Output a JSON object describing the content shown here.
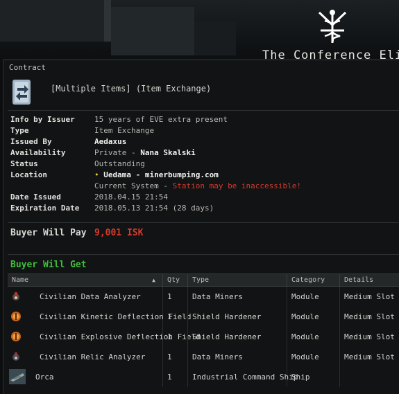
{
  "background": {
    "corp_title": "The Conference Elite",
    "logo_icon": "caduceus-logo-icon"
  },
  "window": {
    "title": "Contract",
    "contract_icon": "contract-scroll-icon",
    "contract_name": "[Multiple Items] (Item Exchange)"
  },
  "info": {
    "info_by_issuer_label": "Info by Issuer",
    "info_by_issuer": "15 years of EVE extra present",
    "type_label": "Type",
    "type": "Item Exchange",
    "issued_by_label": "Issued By",
    "issued_by": "Aedaxus",
    "availability_label": "Availability",
    "availability_prefix": "Private - ",
    "availability_name": "Nana Skalski",
    "status_label": "Status",
    "status": "Outstanding",
    "location_label": "Location",
    "location": "Uedama - minerbumping.com",
    "current_system_prefix": "Current System - ",
    "current_system_warning": "Station may be inaccessible!",
    "date_issued_label": "Date Issued",
    "date_issued": "2018.04.15 21:54",
    "expiration_label": "Expiration Date",
    "expiration": "2018.05.13 21:54 (28 days)"
  },
  "buyer_will_pay_label": "Buyer Will Pay",
  "buyer_will_pay": "9,001 ISK",
  "buyer_will_get_label": "Buyer Will Get",
  "table": {
    "headers": [
      "Name",
      "Qty",
      "Type",
      "Category",
      "Details"
    ],
    "rows": [
      {
        "icon": "data-analyzer-icon",
        "name": "Civilian Data Analyzer",
        "qty": "1",
        "type": "Data Miners",
        "category": "Module",
        "details": "Medium Slot"
      },
      {
        "icon": "shield-hardener-icon",
        "name": "Civilian Kinetic Deflection Field",
        "qty": "1",
        "type": "Shield Hardener",
        "category": "Module",
        "details": "Medium Slot"
      },
      {
        "icon": "shield-hardener-icon",
        "name": "Civilian Explosive Deflection Field",
        "qty": "1",
        "type": "Shield Hardener",
        "category": "Module",
        "details": "Medium Slot"
      },
      {
        "icon": "relic-analyzer-icon",
        "name": "Civilian Relic Analyzer",
        "qty": "1",
        "type": "Data Miners",
        "category": "Module",
        "details": "Medium Slot"
      },
      {
        "icon": "orca-ship-icon",
        "name": "Orca",
        "qty": "1",
        "type": "Industrial Command Ship",
        "category": "Ship",
        "details": ""
      }
    ]
  },
  "colors": {
    "red": "#d63a2c",
    "green": "#3fbf3a",
    "yellow": "#e6cc2e"
  }
}
